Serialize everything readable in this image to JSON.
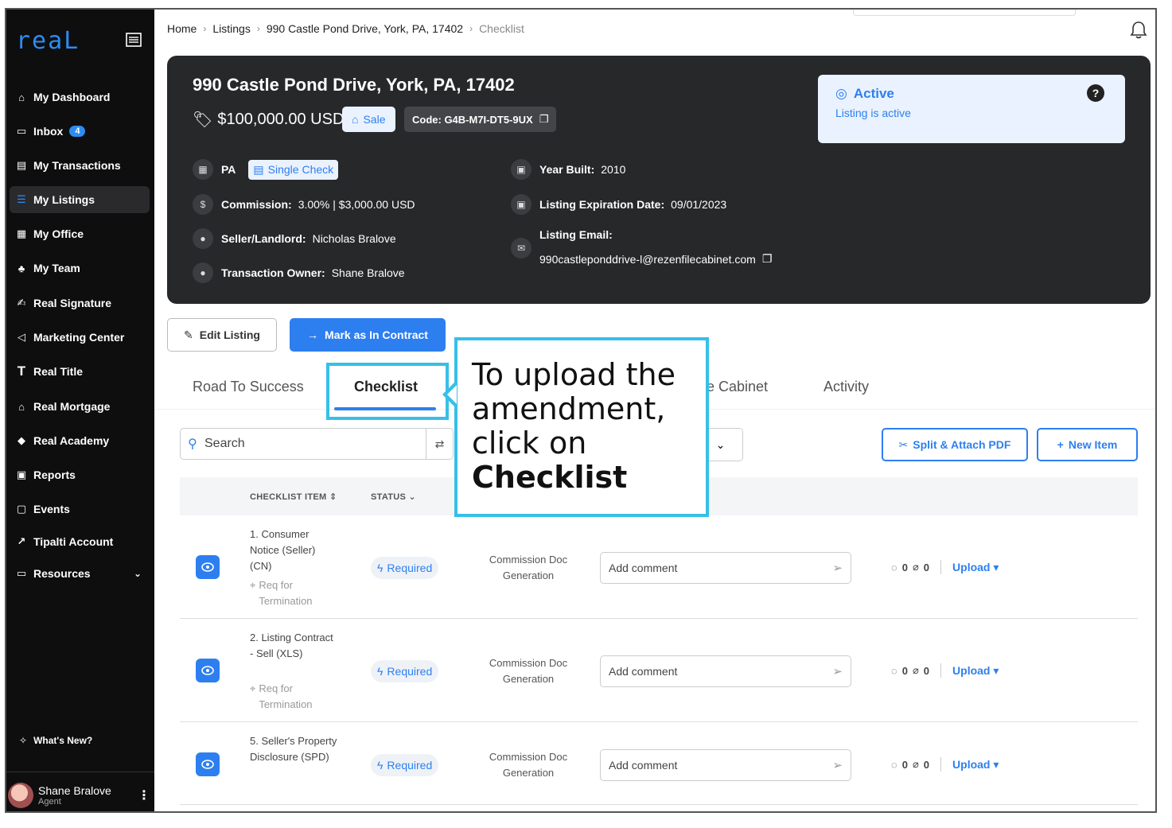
{
  "sidebar": {
    "logo": "reaL",
    "items": [
      {
        "label": "My Dashboard"
      },
      {
        "label": "Inbox",
        "badge": "4"
      },
      {
        "label": "My Transactions"
      },
      {
        "label": "My Listings"
      },
      {
        "label": "My Office"
      },
      {
        "label": "My Team"
      },
      {
        "label": "Real Signature"
      },
      {
        "label": "Marketing Center"
      },
      {
        "label": "Real Title"
      },
      {
        "label": "Real Mortgage"
      },
      {
        "label": "Real Academy"
      },
      {
        "label": "Reports"
      },
      {
        "label": "Events"
      },
      {
        "label": "Tipalti Account"
      },
      {
        "label": "Resources"
      }
    ],
    "whats_new": "What's New?",
    "user": {
      "name": "Shane Bralove",
      "role": "Agent"
    }
  },
  "breadcrumb": [
    "Home",
    "Listings",
    "990 Castle Pond Drive, York, PA, 17402",
    "Checklist"
  ],
  "listing": {
    "title": "990 Castle Pond Drive, York, PA, 17402",
    "price": "$100,000.00 USD",
    "type": "Sale",
    "code": "Code: G4B-M7I-DT5-9UX",
    "state": "PA",
    "check_type": "Single Check",
    "commission_label": "Commission:",
    "commission_value": "3.00% | $3,000.00 USD",
    "seller_label": "Seller/Landlord:",
    "seller_value": "Nicholas Bralove",
    "owner_label": "Transaction Owner:",
    "owner_value": "Shane Bralove",
    "year_label": "Year Built:",
    "year_value": "2010",
    "expiration_label": "Listing Expiration Date:",
    "expiration_value": "09/01/2023",
    "email_label": "Listing Email:",
    "email_value": "990castleponddrive-l@rezenfilecabinet.com",
    "status_title": "Active",
    "status_sub": "Listing is active"
  },
  "actions": {
    "edit": "Edit Listing",
    "contract": "Mark as In Contract"
  },
  "tabs": [
    "Road To Success",
    "Checklist",
    "e Cabinet",
    "Activity"
  ],
  "toolbar": {
    "search_placeholder": "Search",
    "split_attach": "Split & Attach PDF",
    "new_item": "New Item"
  },
  "table": {
    "headers": [
      "CHECKLIST ITEM",
      "STATUS"
    ],
    "rows": [
      {
        "name": "1. Consumer Notice (Seller) (CN)",
        "tag": "Req for Termination",
        "status": "Required",
        "owner": "Commission Doc Generation",
        "comment_placeholder": "Add comment",
        "comments": "0",
        "attachments": "0",
        "upload": "Upload"
      },
      {
        "name": "2. Listing Contract - Sell (XLS)",
        "tag": "Req for Termination",
        "status": "Required",
        "owner": "Commission Doc Generation",
        "comment_placeholder": "Add comment",
        "comments": "0",
        "attachments": "0",
        "upload": "Upload"
      },
      {
        "name": "5. Seller's Property Disclosure (SPD)",
        "tag": "",
        "status": "Required",
        "owner": "Commission Doc Generation",
        "comment_placeholder": "Add comment",
        "comments": "0",
        "attachments": "0",
        "upload": "Upload"
      }
    ]
  },
  "callout": {
    "text_1": "To upload the amendment, click on ",
    "text_bold": "Checklist"
  },
  "colors": {
    "accent": "#2d7ff0",
    "highlight": "#36bfe8",
    "sidebar": "#0e0e0f",
    "card": "#27282a"
  }
}
